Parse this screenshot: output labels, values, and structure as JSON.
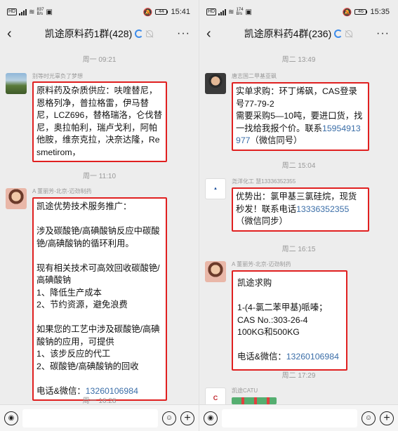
{
  "left": {
    "status": {
      "speed_num": "837",
      "speed_unit": "B/s",
      "time": "15:41",
      "battery": "44"
    },
    "title": "凯途原料药1群(428)",
    "messages": [
      {
        "time": "周一 09:21",
        "sender": "别等时光辜负了梦想",
        "text": "原料药及杂质供应：呋喹替尼，恩格列净，普拉格雷，伊马替尼，LCZ696，替格瑞洛，仑伐替尼，奥拉帕利，瑞卢戈利，阿帕他胺，维奈克拉，决奈达隆，Resmetirom，"
      },
      {
        "time": "周一 11:10",
        "sender": "A 董丽芳-北京-迈劲制药",
        "text": "凯途优势技术服务推广：\n\n涉及碳酸铯/高碘酸钠反应中碳酸铯/高碘酸钠的循环利用。\n\n现有相关技术可高效回收碳酸铯/高碘酸钠\n1、降低生产成本\n2、节约资源，避免浪费\n\n如果您的工艺中涉及碳酸铯/高碘酸钠的应用，可提供\n1、该步反应的代工\n2、碳酸铯/高碘酸钠的回收\n\n电话&微信：",
        "phone": "13260106984"
      },
      {
        "time": "周一 16:28"
      }
    ]
  },
  "right": {
    "status": {
      "speed_num": "174",
      "speed_unit": "B/s",
      "time": "15:35",
      "battery": "46"
    },
    "title": "凯途原料药4群(236)",
    "messages": [
      {
        "time": "周二 13:49",
        "sender": "唐志国二甲基亚砜",
        "text": "实单求购：环丁烯砜，CAS登录号77-79-2\n需要采购5—10吨，要进口货，找一找给我报个价。联系",
        "phone": "15954913977",
        "after": "（微信同号）"
      },
      {
        "time": "周二 15:04",
        "sender": "尧洋化工 慧13336352355",
        "text": "优势出：氯甲基三氯硅烷，现货秒发！联系电话",
        "phone": "13336352355",
        "after": "（微信同步）"
      },
      {
        "time": "周二 16:15",
        "sender": "A 董丽芳-北京-迈劲制药",
        "text": "凯途求购\n\n1-(4-氯二苯甲基)哌嗪；\nCAS No.:303-26-4\n100KG和500KG\n\n电话&微信：",
        "phone": "13260106984"
      },
      {
        "time": "周二 17:29",
        "sender": "凯途CATU"
      }
    ]
  },
  "icons": {
    "back": "‹",
    "more": "···",
    "voice": "◉",
    "emoji": "☺",
    "plus": "+"
  }
}
